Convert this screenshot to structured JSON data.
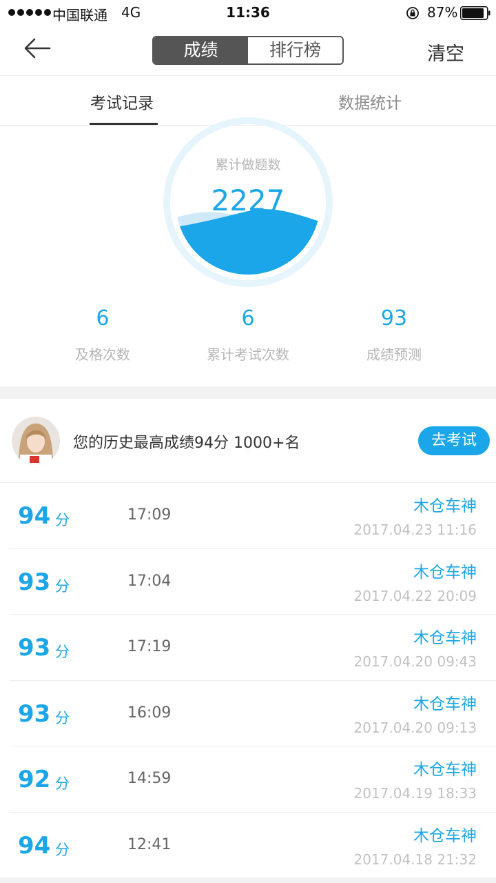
{
  "status_bar": {
    "carrier": "中国联通",
    "network": "4G",
    "time": "11:36",
    "battery": "87%"
  },
  "nav": {
    "segments": [
      "成绩",
      "排行榜"
    ],
    "active_segment": "成绩",
    "clear_label": "清空"
  },
  "tabs": [
    "考试记录",
    "数据统计"
  ],
  "active_tab": "考试记录",
  "gauge": {
    "label": "累计做题数",
    "value": "2227"
  },
  "stats": [
    {
      "value": "6",
      "label": "及格次数"
    },
    {
      "value": "6",
      "label": "累计考试次数"
    },
    {
      "value": "93",
      "label": "成绩预测"
    }
  ],
  "best": {
    "text": "您的历史最高成绩94分  1000+名",
    "button_label": "去考试"
  },
  "records": [
    {
      "score": "94",
      "unit": "分",
      "duration": "17:09",
      "name": "木仓车神",
      "date": "2017.04.23 11:16"
    },
    {
      "score": "93",
      "unit": "分",
      "duration": "17:04",
      "name": "木仓车神",
      "date": "2017.04.22 20:09"
    },
    {
      "score": "93",
      "unit": "分",
      "duration": "17:19",
      "name": "木仓车神",
      "date": "2017.04.20 09:43"
    },
    {
      "score": "93",
      "unit": "分",
      "duration": "16:09",
      "name": "木仓车神",
      "date": "2017.04.20 09:13"
    },
    {
      "score": "92",
      "unit": "分",
      "duration": "14:59",
      "name": "木仓车神",
      "date": "2017.04.19 18:33"
    },
    {
      "score": "94",
      "unit": "分",
      "duration": "12:41",
      "name": "木仓车神",
      "date": "2017.04.18 21:32"
    }
  ],
  "colors": {
    "accent": "#1aa6e8",
    "segment_active": "#555555",
    "muted_text": "#b5b5b5"
  },
  "icons": [
    "back-arrow-icon",
    "orientation-lock-icon",
    "battery-icon",
    "signal-dots-icon"
  ]
}
